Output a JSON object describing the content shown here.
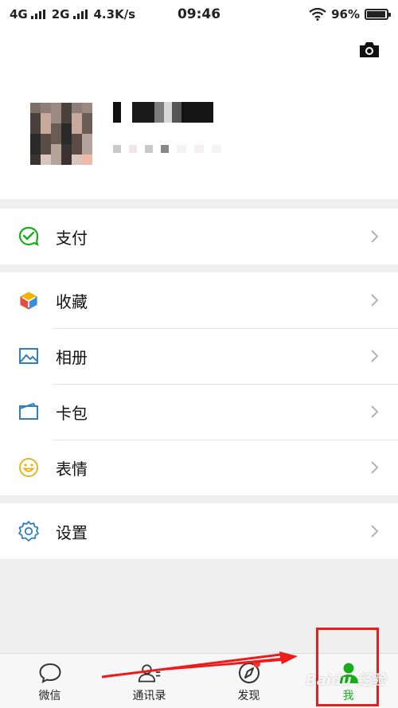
{
  "status_bar": {
    "network1": "4G",
    "network2": "2G",
    "speed": "4.3K/s",
    "time": "09:46",
    "battery": "96%",
    "battery_level": 0.96
  },
  "profile": {
    "camera_icon": "camera-icon",
    "avatar": "pixelated-avatar",
    "nickname": "",
    "wechat_id": ""
  },
  "menu": {
    "pay": {
      "label": "支付",
      "icon": "pay-icon",
      "color": "#1aad19"
    },
    "favorites": {
      "label": "收藏",
      "icon": "cube-icon"
    },
    "album": {
      "label": "相册",
      "icon": "image-icon",
      "color": "#2f80c2"
    },
    "cards": {
      "label": "卡包",
      "icon": "wallet-icon",
      "color": "#2f80c2"
    },
    "stickers": {
      "label": "表情",
      "icon": "smiley-icon",
      "color": "#e8b320"
    },
    "settings": {
      "label": "设置",
      "icon": "gear-icon",
      "color": "#2f80c2"
    }
  },
  "tabbar": {
    "tabs": [
      {
        "label": "微信",
        "icon": "chat-bubble-icon"
      },
      {
        "label": "通讯录",
        "icon": "contacts-icon"
      },
      {
        "label": "发现",
        "icon": "compass-icon"
      },
      {
        "label": "我",
        "icon": "person-icon"
      }
    ],
    "active_color": "#1aad19"
  },
  "annotation": {
    "watermark": "Baidu 经验",
    "arrow_color": "#ee1b1b"
  }
}
